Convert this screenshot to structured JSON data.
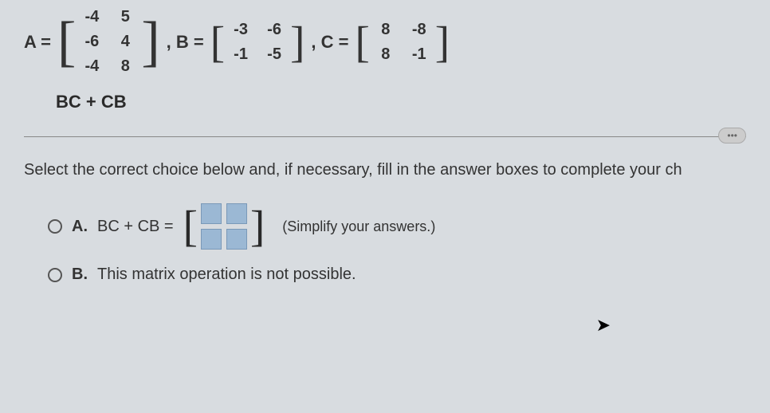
{
  "eq": {
    "A_label": "A =",
    "A": [
      [
        "-4",
        "5"
      ],
      [
        "-6",
        "4"
      ],
      [
        "-4",
        "8"
      ]
    ],
    "B_label": ", B =",
    "B": [
      [
        "-3",
        "-6"
      ],
      [
        "-1",
        "-5"
      ]
    ],
    "C_label": ", C =",
    "C": [
      [
        "8",
        "-8"
      ],
      [
        "8",
        "-1"
      ]
    ]
  },
  "operation": "BC + CB",
  "pill": "•••",
  "instruction": "Select the correct choice below and, if necessary, fill in the answer boxes to complete your ch",
  "choiceA": {
    "label": "A.",
    "text": "BC + CB =",
    "hint": "(Simplify your answers.)"
  },
  "choiceB": {
    "label": "B.",
    "text": "This matrix operation is not possible."
  },
  "chart_data": {
    "type": "table",
    "matrices": {
      "A": [
        [
          -4,
          5
        ],
        [
          -6,
          4
        ],
        [
          -4,
          8
        ]
      ],
      "B": [
        [
          -3,
          -6
        ],
        [
          -1,
          -5
        ]
      ],
      "C": [
        [
          8,
          -8
        ],
        [
          8,
          -1
        ]
      ]
    },
    "expression": "BC + CB"
  }
}
